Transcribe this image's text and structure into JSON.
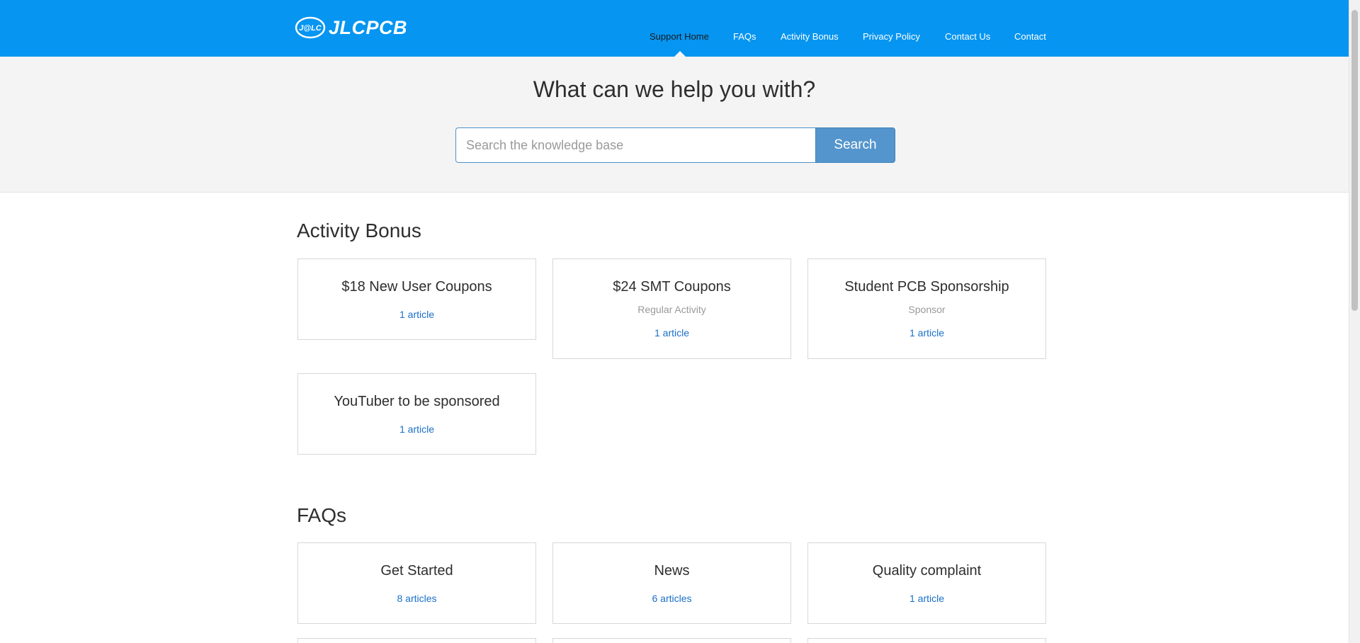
{
  "header": {
    "logo_badge": "J@LC",
    "logo_text": "JLCPCB",
    "nav": [
      {
        "label": "Support Home",
        "active": true
      },
      {
        "label": "FAQs"
      },
      {
        "label": "Activity Bonus"
      },
      {
        "label": "Privacy Policy"
      },
      {
        "label": "Contact Us"
      },
      {
        "label": "Contact"
      }
    ]
  },
  "hero": {
    "title": "What can we help you with?",
    "search_placeholder": "Search the knowledge base",
    "search_button": "Search"
  },
  "sections": [
    {
      "title": "Activity Bonus",
      "cards": [
        {
          "title": "$18 New User Coupons",
          "subtitle": "",
          "count": "1 article"
        },
        {
          "title": "$24 SMT Coupons",
          "subtitle": "Regular Activity",
          "count": "1 article"
        },
        {
          "title": "Student PCB Sponsorship",
          "subtitle": "Sponsor",
          "count": "1 article"
        },
        {
          "title": "YouTuber to be sponsored",
          "subtitle": "",
          "count": "1 article"
        }
      ]
    },
    {
      "title": "FAQs",
      "cards": [
        {
          "title": "Get Started",
          "subtitle": "",
          "count": "8 articles"
        },
        {
          "title": "News",
          "subtitle": "",
          "count": "6 articles"
        },
        {
          "title": "Quality complaint",
          "subtitle": "",
          "count": "1 article"
        }
      ]
    }
  ],
  "colors": {
    "header_bg": "#0695f1",
    "hero_bg": "#f4f4f4",
    "search_button_bg": "#5495cd",
    "link": "#1a6fc9"
  }
}
